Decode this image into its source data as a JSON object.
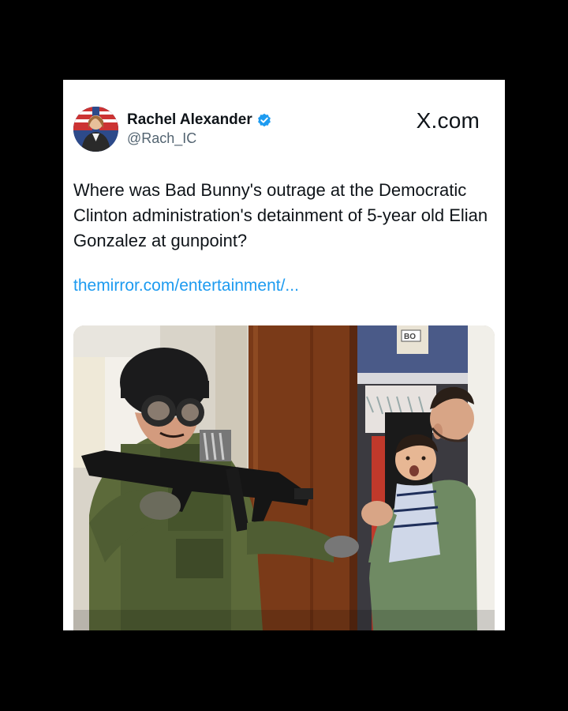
{
  "post": {
    "author_name": "Rachel Alexander",
    "author_handle": "@Rach_IC",
    "brand": "X.com",
    "text": "Where was Bad Bunny's outrage at the Democratic Clinton administration's detainment of 5-year old Elian Gonzalez at gunpoint?",
    "link": "themirror.com/entertainment/...",
    "photo_box_label": "BO"
  },
  "colors": {
    "background": "#000000",
    "card": "#ffffff",
    "link": "#1d9bf0",
    "verified": "#1d9bf0",
    "text": "#0f1419",
    "muted": "#536471"
  },
  "icons": {
    "verified": "verified-badge-icon"
  }
}
